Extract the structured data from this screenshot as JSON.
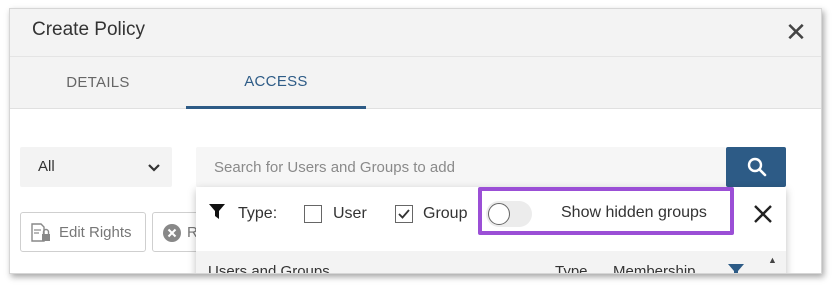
{
  "dialog": {
    "title": "Create Policy",
    "close_icon": "close-icon"
  },
  "tabs": [
    {
      "label": "DETAILS",
      "active": false
    },
    {
      "label": "ACCESS",
      "active": true
    }
  ],
  "filter_select": {
    "value": "All",
    "icon": "chevron-down-icon"
  },
  "search": {
    "placeholder": "Search for Users and Groups to add",
    "value": "",
    "button_icon": "search-icon"
  },
  "actions": {
    "edit_rights_label": "Edit Rights",
    "edit_rights_icon": "lock-document-icon",
    "second_label": "R",
    "second_icon": "remove-circle-icon"
  },
  "type_filter": {
    "label": "Type:",
    "options": [
      {
        "label": "User",
        "checked": false
      },
      {
        "label": "Group",
        "checked": true
      }
    ]
  },
  "hidden_groups_toggle": {
    "label": "Show hidden groups",
    "on": false
  },
  "table": {
    "columns": [
      "Users and Groups",
      "Type",
      "Membership"
    ]
  },
  "colors": {
    "accent": "#2d5b86",
    "highlight": "#9b4fd6",
    "header_bg": "#f3f3f3"
  }
}
